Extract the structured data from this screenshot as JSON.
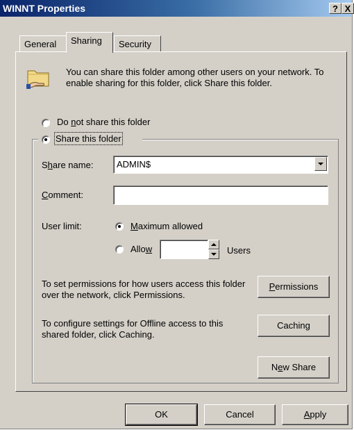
{
  "window": {
    "title": "WINNT Properties",
    "help_glyph": "?",
    "close_glyph": "X"
  },
  "tabs": [
    {
      "label": "General"
    },
    {
      "label": "Sharing"
    },
    {
      "label": "Security"
    }
  ],
  "sharing": {
    "info_text": "You can share this folder among other users on your network.  To enable sharing for this folder, click Share this folder.",
    "folder_icon": "shared-folder-icon",
    "do_not_share": {
      "pre": "Do ",
      "mnemonic": "n",
      "post": "ot share this folder",
      "checked": false
    },
    "share_this": {
      "label": "Share this folder",
      "checked": true
    },
    "share_name": {
      "pre": "S",
      "mnemonic": "h",
      "post": "are name:",
      "value": "ADMIN$"
    },
    "comment": {
      "pre": "",
      "mnemonic": "C",
      "post": "omment:",
      "value": ""
    },
    "user_limit": {
      "label": "User limit:",
      "maximum": {
        "pre": "",
        "mnemonic": "M",
        "post": "aximum allowed",
        "checked": true
      },
      "allow": {
        "pre": "Allo",
        "mnemonic": "w",
        "post": "",
        "checked": false,
        "value": ""
      },
      "users_label": "Users"
    },
    "permissions_text": "To set permissions for how users access this folder over the network, click Permissions.",
    "permissions_button": {
      "pre": "",
      "mnemonic": "P",
      "post": "ermissions"
    },
    "caching_text": "To configure settings for Offline access to this shared folder, click Caching.",
    "caching_button": {
      "pre": "Cachin",
      "mnemonic": "g",
      "post": ""
    },
    "new_share_button": {
      "pre": "N",
      "mnemonic": "e",
      "post": "w Share"
    }
  },
  "footer": {
    "ok": "OK",
    "cancel": "Cancel",
    "apply": {
      "pre": "",
      "mnemonic": "A",
      "post": "pply"
    }
  }
}
